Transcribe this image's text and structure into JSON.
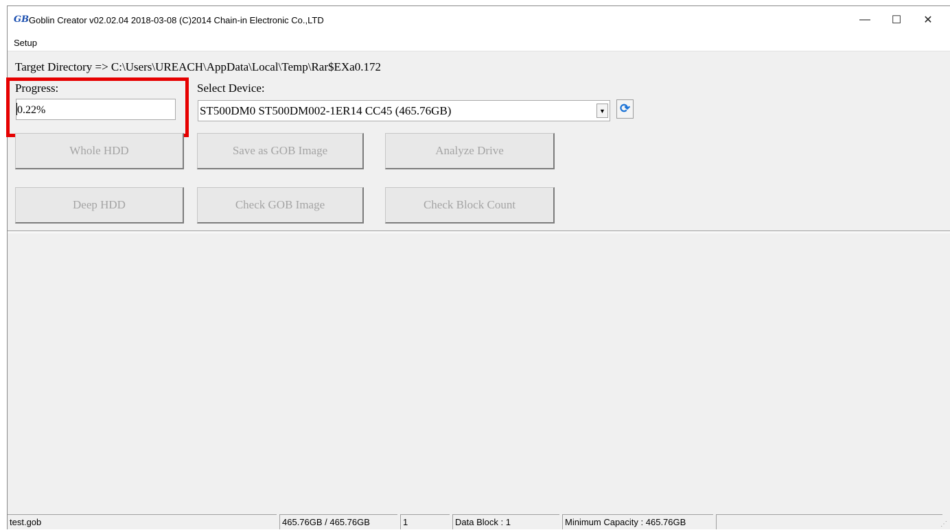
{
  "window": {
    "title": "Goblin Creator v02.02.04 2018-03-08  (C)2014 Chain-in Electronic Co.,LTD",
    "app_icon_text": "GB",
    "minimize_symbol": "—",
    "maximize_symbol": "☐",
    "close_symbol": "✕"
  },
  "menu": {
    "setup": "Setup"
  },
  "target_directory": "Target Directory => C:\\Users\\UREACH\\AppData\\Local\\Temp\\Rar$EXa0.172",
  "progress": {
    "label": "Progress:",
    "value": "0.22%"
  },
  "device": {
    "label": "Select Device:",
    "selected": "ST500DM0 ST500DM002-1ER14 CC45 (465.76GB)",
    "refresh_icon": "refresh-icon"
  },
  "buttons": {
    "whole_hdd": "Whole HDD",
    "save_gob_image": "Save as GOB Image",
    "analyze_drive": "Analyze Drive",
    "deep_hdd": "Deep HDD",
    "check_gob_image": "Check GOB Image",
    "check_block_count": "Check Block Count"
  },
  "status": {
    "file": "test.gob",
    "capacity": "465.76GB / 465.76GB",
    "count": "1",
    "data_block": "Data Block : 1",
    "minimum_capacity": "Minimum Capacity : 465.76GB",
    "empty": ""
  },
  "colors": {
    "highlight": "#e60000",
    "accent_refresh": "#1a72d6",
    "disabled_text": "#a4a4a4"
  }
}
